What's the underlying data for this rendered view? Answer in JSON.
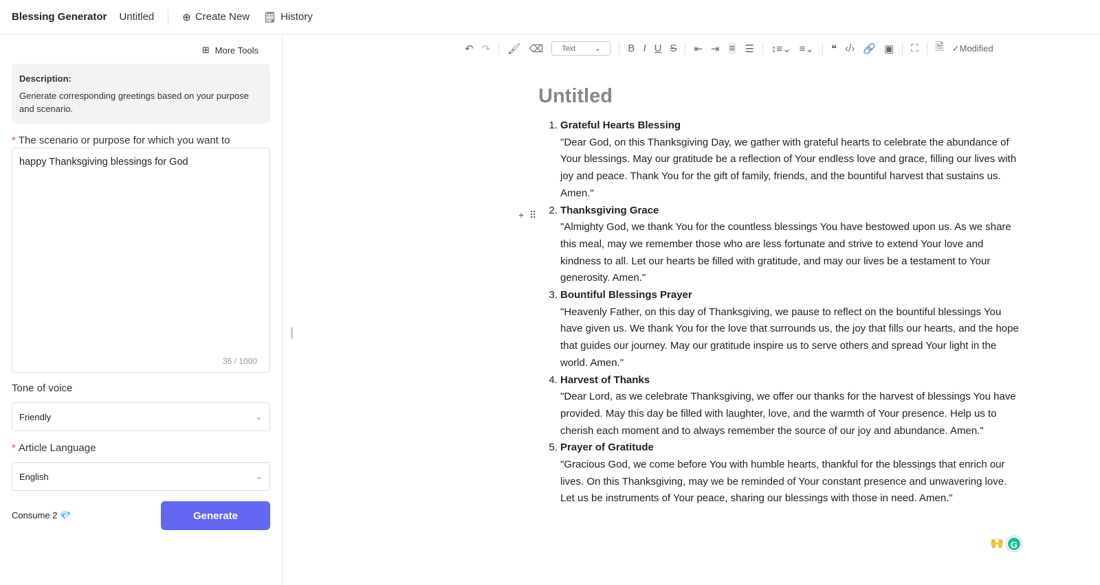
{
  "header": {
    "app_name": "Blessing Generator",
    "doc_name": "Untitled",
    "create_new": "Create New",
    "history": "History"
  },
  "sidebar": {
    "more_tools": "More Tools",
    "description_title": "Description:",
    "description": "Generate corresponding greetings based on your purpose and scenario.",
    "scenario_label": "The scenario or purpose for which you want to generate greetings",
    "scenario_value": "happy Thanksgiving blessings for God",
    "char_count": "36 / 1000",
    "tone_label": "Tone of voice",
    "tone_value": "Friendly",
    "language_label": "Article Language",
    "language_value": "English",
    "consume": "Consume 2",
    "generate": "Generate"
  },
  "toolbar": {
    "text_style": "Text",
    "status": "Modified"
  },
  "editor": {
    "title": "Untitled",
    "items": [
      {
        "heading": "Grateful Hearts Blessing",
        "body": "\"Dear God, on this Thanksgiving Day, we gather with grateful hearts to celebrate the abundance of Your blessings. May our gratitude be a reflection of Your endless love and grace, filling our lives with joy and peace. Thank You for the gift of family, friends, and the bountiful harvest that sustains us. Amen.\""
      },
      {
        "heading": "Thanksgiving Grace",
        "body": "\"Almighty God, we thank You for the countless blessings You have bestowed upon us. As we share this meal, may we remember those who are less fortunate and strive to extend Your love and kindness to all. Let our hearts be filled with gratitude, and may our lives be a testament to Your generosity. Amen.\""
      },
      {
        "heading": "Bountiful Blessings Prayer",
        "body": "\"Heavenly Father, on this day of Thanksgiving, we pause to reflect on the bountiful blessings You have given us. We thank You for the love that surrounds us, the joy that fills our hearts, and the hope that guides our journey. May our gratitude inspire us to serve others and spread Your light in the world. Amen.\""
      },
      {
        "heading": "Harvest of Thanks",
        "body": "\"Dear Lord, as we celebrate Thanksgiving, we offer our thanks for the harvest of blessings You have provided. May this day be filled with laughter, love, and the warmth of Your presence. Help us to cherish each moment and to always remember the source of our joy and abundance. Amen.\""
      },
      {
        "heading": "Prayer of Gratitude",
        "body": "\"Gracious God, we come before You with humble hearts, thankful for the blessings that enrich our lives. On this Thanksgiving, may we be reminded of Your constant presence and unwavering love. Let us be instruments of Your peace, sharing our blessings with those in need. Amen.\""
      }
    ]
  },
  "colors": {
    "accent": "#6366f1",
    "required": "#e5484d"
  }
}
